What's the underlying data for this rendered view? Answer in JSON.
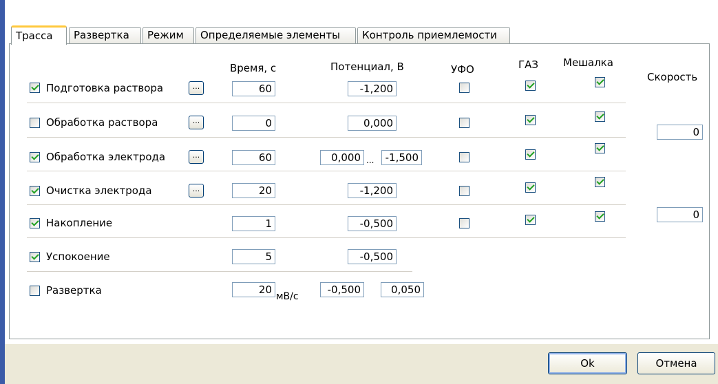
{
  "tabs": [
    "Трасса",
    "Развертка",
    "Режим",
    "Определяемые элементы",
    "Контроль приемлемости"
  ],
  "headers": {
    "time": "Время, с",
    "potential": "Потенциал, В",
    "ufo": "УФО",
    "gas": "ГАЗ",
    "stirrer": "Мешалка",
    "speed": "Скорость"
  },
  "rows": [
    {
      "label": "Подготовка раствора",
      "enabled": true,
      "time": "60",
      "potential": "-1,200",
      "ufo": false,
      "gas": true,
      "stirrer": true
    },
    {
      "label": "Обработка раствора",
      "enabled": false,
      "time": "0",
      "potential": "0,000",
      "ufo": false,
      "gas": true,
      "stirrer": true
    },
    {
      "label": "Обработка электрода",
      "enabled": true,
      "time": "60",
      "potential_from": "0,000",
      "range_sep": "...",
      "potential_to": "-1,500",
      "ufo": false,
      "gas": true,
      "stirrer": true
    },
    {
      "label": "Очистка электрода",
      "enabled": true,
      "time": "20",
      "potential": "-1,200",
      "ufo": false,
      "gas": true,
      "stirrer": true
    },
    {
      "label": "Накопление",
      "enabled": true,
      "time": "1",
      "potential": "-0,500",
      "ufo": false,
      "gas": true,
      "stirrer": true
    },
    {
      "label": "Успокоение",
      "enabled": true,
      "time": "5",
      "potential": "-0,500"
    },
    {
      "label": "Развертка",
      "enabled": false,
      "rate": "20",
      "rate_unit": "мВ/с",
      "potential_from": "-0,500",
      "potential_to": "0,050"
    }
  ],
  "speed_values": [
    "0",
    "0"
  ],
  "dots_label": "...",
  "buttons": {
    "ok": "Ok",
    "cancel": "Отмена"
  }
}
